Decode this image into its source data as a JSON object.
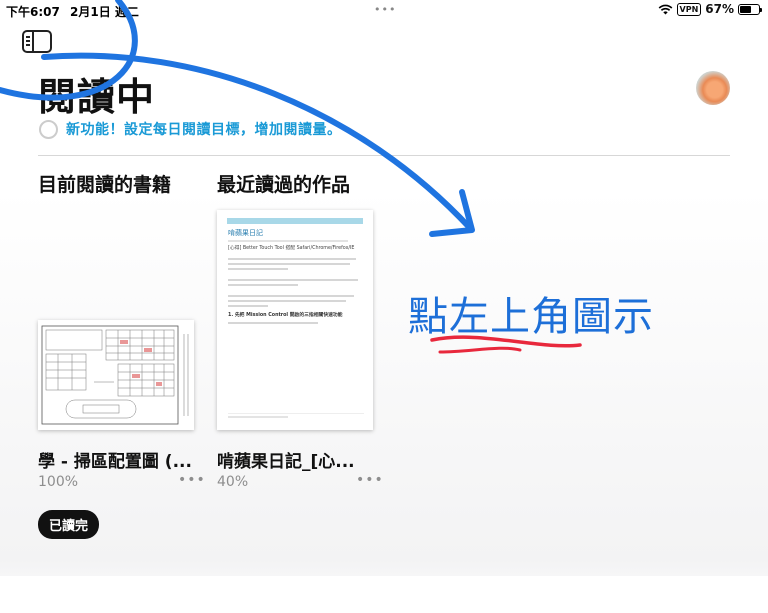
{
  "status": {
    "time": "下午6:07",
    "date": "2月1日 週二",
    "vpn": "VPN",
    "battery": "67%",
    "battery_level": 0.67
  },
  "header": {
    "title": "閱讀中",
    "banner": "新功能！設定每日閱讀目標，增加閱讀量。"
  },
  "sections": {
    "current": "目前閱讀的書籍",
    "recent": "最近讀過的作品"
  },
  "books": [
    {
      "title": "學 - 掃區配置圖 (...",
      "progress": "100%"
    },
    {
      "title": "啃蘋果日記_[心...",
      "progress": "40%"
    }
  ],
  "cover2": {
    "header": "啃蘋果日記",
    "subtitle": "[心得] Better Touch Tool 搭配 Safari/Chrome/Firefox/IE",
    "heading": "1. 先把 Mission Control 開啟的三指相關快速功能"
  },
  "finished_badge": "已讀完",
  "annotation": "點左上角圖示",
  "colors": {
    "banner": "#1a9ad6",
    "annotation_text": "#1d6fd8",
    "annotation_arrow": "#1f74e0",
    "underline": "#e8283c"
  }
}
